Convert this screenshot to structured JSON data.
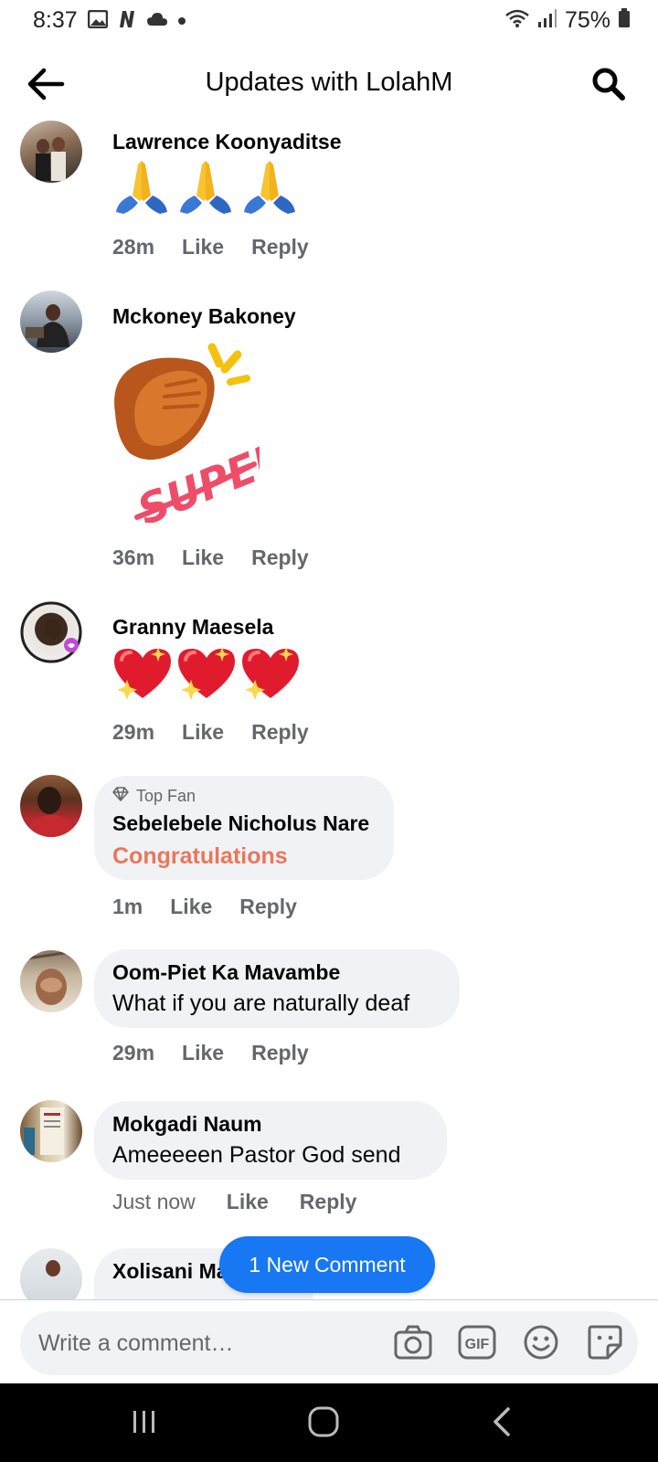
{
  "status_bar": {
    "time": "8:37",
    "battery_pct": "75%",
    "left_icons": [
      "gallery-icon",
      "netflix-n-icon",
      "cloud-icon",
      "dot-icon"
    ],
    "right_icons": [
      "wifi-icon",
      "signal-icon",
      "battery-icon"
    ]
  },
  "header": {
    "title": "Updates with LolahM",
    "back_icon": "arrow-left-icon",
    "search_icon": "search-icon"
  },
  "comments": [
    {
      "name": "Lawrence Koonyaditse",
      "content_type": "emoji",
      "emoji": [
        "🙏",
        "🙏",
        "🙏"
      ],
      "time": "28m",
      "like": "Like",
      "reply": "Reply"
    },
    {
      "name": "Mckoney Bakoney",
      "content_type": "sticker",
      "sticker_text": "SUPER!",
      "time": "36m",
      "like": "Like",
      "reply": "Reply"
    },
    {
      "name": "Granny Maesela",
      "content_type": "emoji",
      "emoji": [
        "💖",
        "💖",
        "💖"
      ],
      "time": "29m",
      "like": "Like",
      "reply": "Reply"
    },
    {
      "name": "Sebelebele Nicholus Nare",
      "badge": "Top Fan",
      "text": "Congratulations",
      "time": "1m",
      "like": "Like",
      "reply": "Reply"
    },
    {
      "name": "Oom-Piet Ka Mavambe",
      "text": "What if you are naturally deaf",
      "time": "29m",
      "like": "Like",
      "reply": "Reply"
    },
    {
      "name": "Mokgadi Naum",
      "text": "Ameeeeen Pastor God send",
      "time": "Just now",
      "like": "Like",
      "reply": "Reply"
    },
    {
      "name": "Xolisani Matiwane"
    }
  ],
  "new_comment_pill": "1 New Comment",
  "composer": {
    "placeholder": "Write a comment…",
    "tools": [
      "camera-icon",
      "gif-icon",
      "emoji-icon",
      "sticker-icon"
    ]
  },
  "colors": {
    "accent_blue": "#1877f2",
    "congrats_text": "#e9775c",
    "bubble_bg": "#f0f2f5",
    "meta_gray": "#65676b"
  }
}
